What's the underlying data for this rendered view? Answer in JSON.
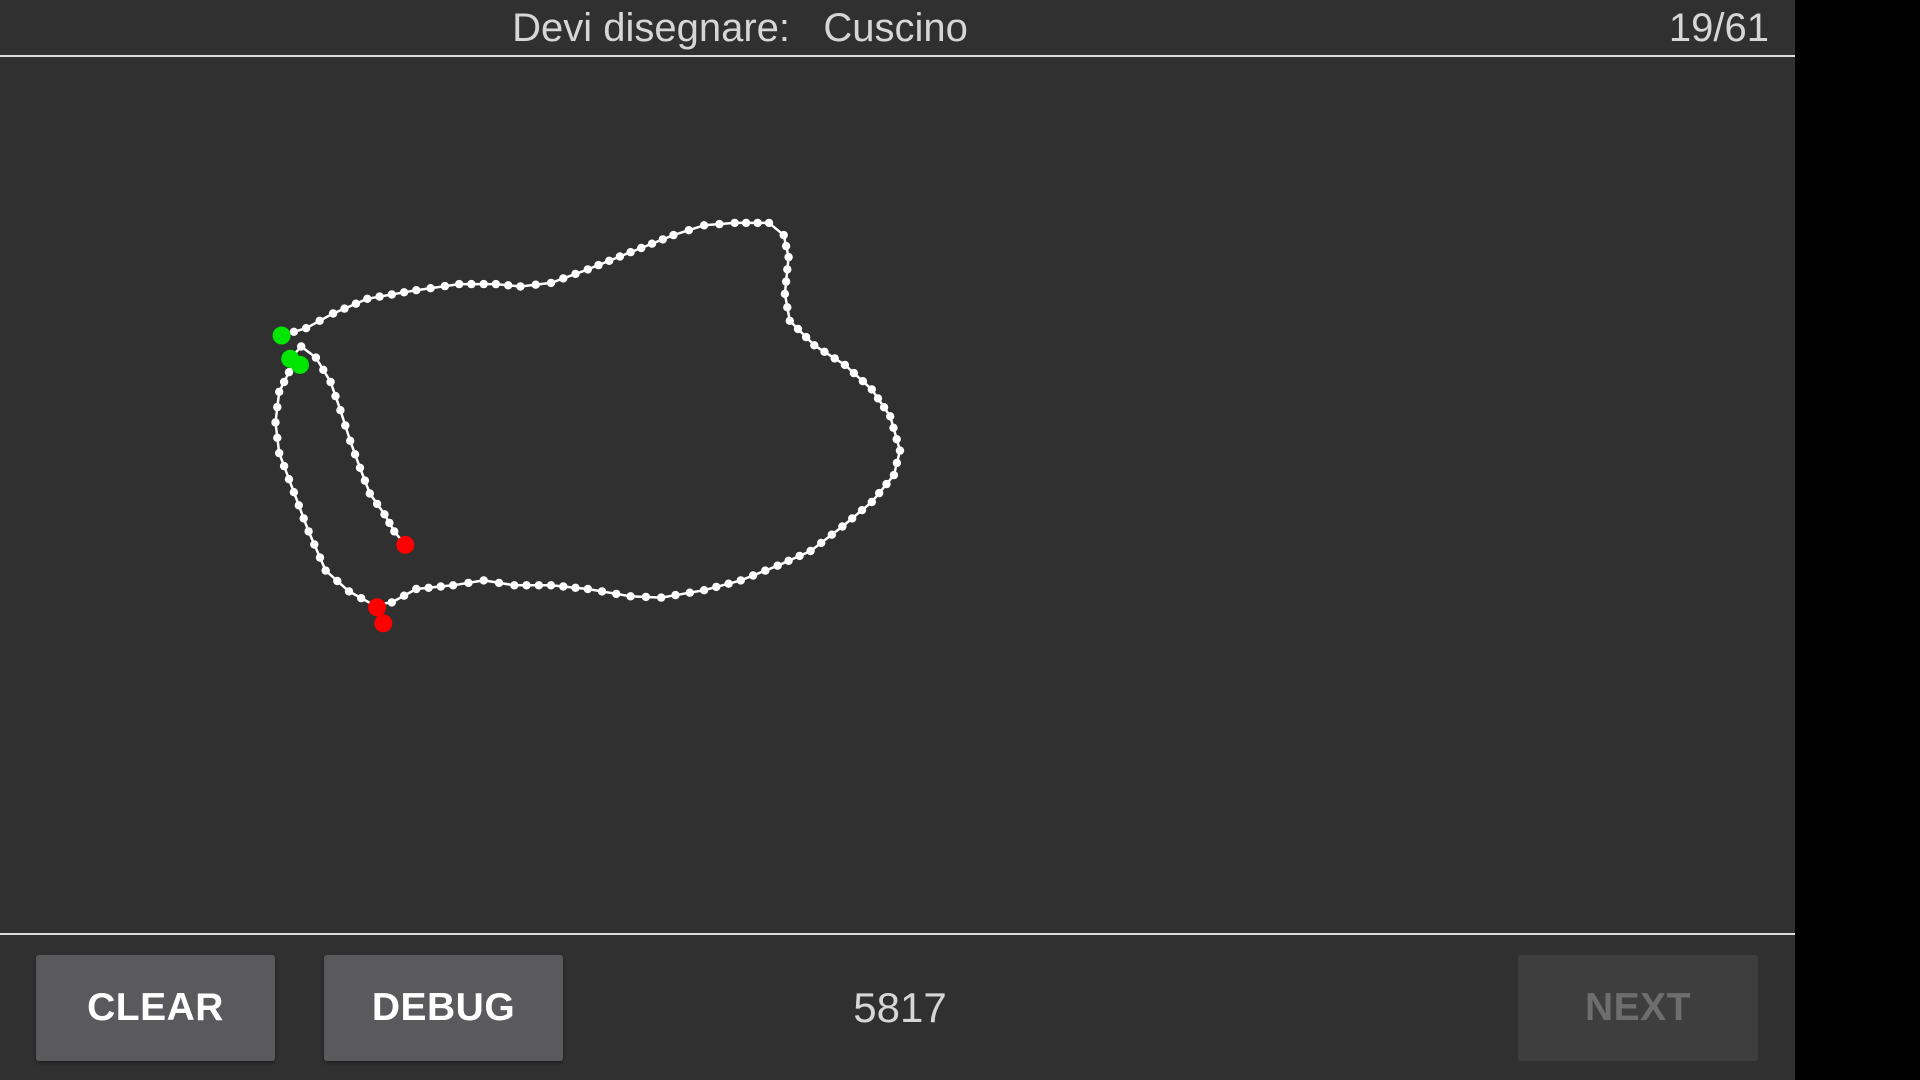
{
  "header": {
    "prompt_label": "Devi disegnare:",
    "prompt_word": "Cuscino",
    "progress": "19/61"
  },
  "colors": {
    "background": "#303030",
    "stroke": "#ffffff",
    "start_point": "#00e600",
    "end_point": "#ff0000",
    "button": "#5a5a5c",
    "button_disabled": "#3e3e3e"
  },
  "footer": {
    "clear_label": "CLEAR",
    "debug_label": "DEBUG",
    "score": "5817",
    "next_label": "NEXT",
    "next_enabled": false
  }
}
